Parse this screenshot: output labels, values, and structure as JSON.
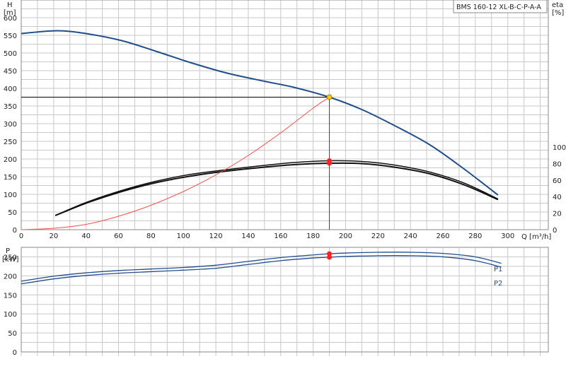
{
  "model_label": "BMS 160-12 XL-B-C-P-A-A",
  "chart_data": [
    {
      "type": "line",
      "title": "",
      "xlabel": "Q [m³/h]",
      "x_unit": "Q [m³/h]",
      "xlim": [
        0,
        325
      ],
      "x_ticks": [
        0,
        20,
        40,
        60,
        80,
        100,
        120,
        140,
        160,
        180,
        200,
        220,
        240,
        260,
        280,
        300
      ],
      "y_left_label": "H",
      "y_left_unit": "[m]",
      "ylim": [
        0,
        650
      ],
      "y_ticks": [
        0,
        50,
        100,
        150,
        200,
        250,
        300,
        350,
        400,
        450,
        500,
        550,
        600
      ],
      "y_right_label": "eta",
      "y_right_unit": "[%]",
      "y_right_lim": [
        0,
        100
      ],
      "y_right_ticks": [
        0,
        20,
        40,
        60,
        80,
        100
      ],
      "grid": true,
      "series": [
        {
          "color": "#1f4e8c",
          "axis": "left",
          "x": [
            0,
            22,
            40,
            62,
            83,
            105,
            127,
            150,
            168,
            190,
            210,
            230,
            252,
            273,
            294
          ],
          "values": [
            555,
            563,
            555,
            535,
            505,
            472,
            443,
            420,
            403,
            375,
            340,
            295,
            240,
            172,
            98
          ]
        },
        {
          "color": "#111111",
          "axis": "left",
          "x": [
            21,
            40,
            62,
            83,
            105,
            127,
            150,
            168,
            190,
            210,
            230,
            252,
            273,
            294
          ],
          "values": [
            40,
            75,
            108,
            133,
            152,
            166,
            177,
            184,
            188,
            187,
            177,
            158,
            127,
            85
          ]
        },
        {
          "color": "#111111",
          "axis": "left",
          "x": [
            21,
            40,
            62,
            83,
            105,
            127,
            150,
            168,
            190,
            210,
            230,
            252,
            273,
            294
          ],
          "values": [
            40,
            77,
            111,
            137,
            157,
            170,
            182,
            190,
            195,
            193,
            183,
            163,
            132,
            87
          ]
        },
        {
          "color": "#ff4d4d",
          "axis": "left",
          "x": [
            0,
            20,
            40,
            60,
            80,
            100,
            120,
            140,
            160,
            180,
            190
          ],
          "values": [
            0,
            4,
            15,
            38,
            69,
            108,
            155,
            210,
            274,
            344,
            375
          ]
        }
      ],
      "duty_point": {
        "x": 190,
        "h": 375,
        "eta_values": [
          188,
          195
        ]
      }
    },
    {
      "type": "line",
      "title": "",
      "xlabel": "",
      "xlim": [
        0,
        325
      ],
      "y_left_label": "P",
      "y_left_unit": "[kW]",
      "ylim": [
        0,
        275
      ],
      "y_ticks": [
        0,
        50,
        100,
        150,
        200,
        250
      ],
      "grid": true,
      "series": [
        {
          "name": "P1",
          "color": "#1f4e8c",
          "x": [
            0,
            20,
            40,
            60,
            80,
            100,
            120,
            140,
            160,
            180,
            190,
            200,
            220,
            240,
            260,
            280,
            296
          ],
          "values": [
            186,
            199,
            208,
            214,
            218,
            222,
            228,
            238,
            248,
            255,
            258,
            260,
            262,
            262,
            259,
            250,
            233
          ]
        },
        {
          "name": "P2",
          "color": "#1f4e8c",
          "x": [
            0,
            20,
            40,
            60,
            80,
            100,
            120,
            140,
            160,
            180,
            190,
            200,
            220,
            240,
            260,
            280,
            296
          ],
          "values": [
            179,
            192,
            201,
            207,
            211,
            215,
            220,
            230,
            240,
            247,
            249,
            251,
            253,
            253,
            250,
            240,
            223
          ]
        }
      ],
      "duty_point": {
        "x": 190,
        "values": [
          249,
          258
        ]
      }
    }
  ]
}
